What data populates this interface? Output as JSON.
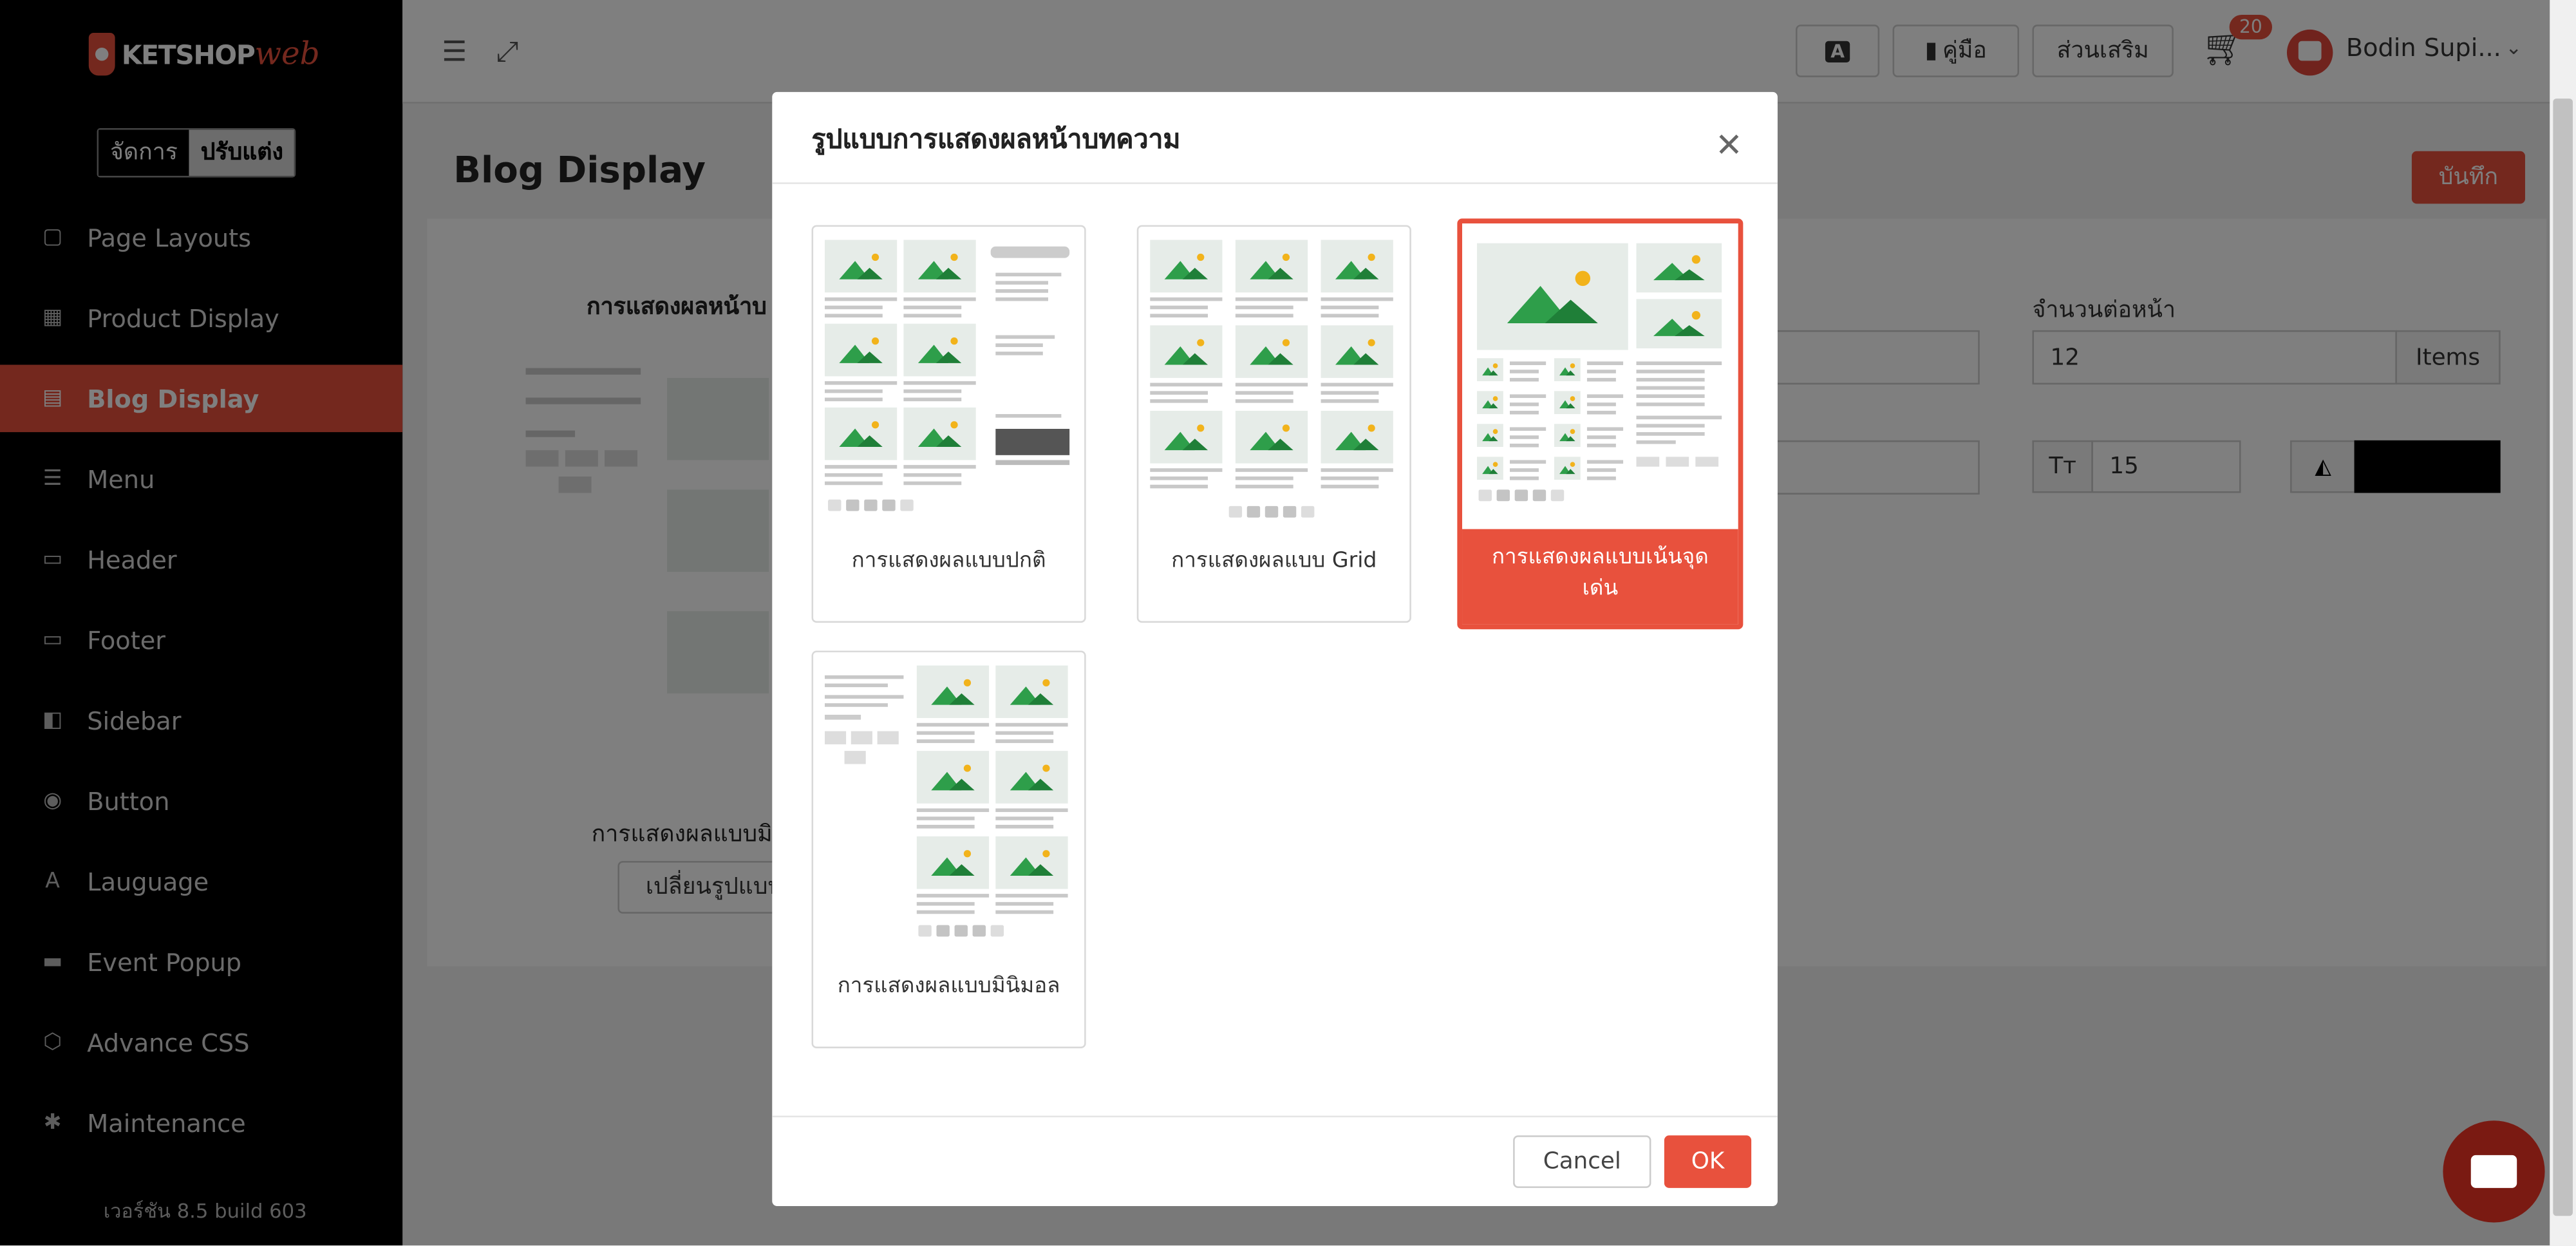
{
  "app": {
    "logo_text_1": "KETSHOP",
    "logo_text_2": "web",
    "mode_manage": "จัดการ",
    "mode_customize": "ปรับแต่ง",
    "version": "เวอร์ชัน 8.5 build 603"
  },
  "sidebar": {
    "items": [
      {
        "label": "Page Layouts",
        "icon": "page-layouts-icon",
        "glyph": "▢"
      },
      {
        "label": "Product Display",
        "icon": "product-display-icon",
        "glyph": "▦"
      },
      {
        "label": "Blog Display",
        "icon": "blog-display-icon",
        "glyph": "▤"
      },
      {
        "label": "Menu",
        "icon": "menu-icon",
        "glyph": "☰"
      },
      {
        "label": "Header",
        "icon": "header-icon",
        "glyph": "▭"
      },
      {
        "label": "Footer",
        "icon": "footer-icon",
        "glyph": "▭"
      },
      {
        "label": "Sidebar",
        "icon": "sidebar-icon",
        "glyph": "◧"
      },
      {
        "label": "Button",
        "icon": "toggle-icon",
        "glyph": "◉"
      },
      {
        "label": "Lauguage",
        "icon": "language-icon",
        "glyph": "A"
      },
      {
        "label": "Event Popup",
        "icon": "ticket-icon",
        "glyph": "▬"
      },
      {
        "label": "Advance CSS",
        "icon": "css3-icon",
        "glyph": "⬡"
      },
      {
        "label": "Maintenance",
        "icon": "bug-icon",
        "glyph": "✱"
      }
    ],
    "active_index": 2
  },
  "topbar": {
    "translate_icon": "translate-icon",
    "manual_label": "คู่มือ",
    "addon_label": "ส่วนเสริม",
    "cart_count": "20",
    "username": "Bodin Supi...",
    "chevron": "⌄"
  },
  "page": {
    "title": "Blog Display",
    "save_label": "บันทึก",
    "section_label": "การแสดงผลหน้าบ",
    "current_style": "การแสดงผลแบบมิ",
    "change_button": "เปลี่ยนรูปแบบ",
    "per_page_label": "จำนวนต่อหน้า",
    "per_page_value": "12",
    "per_page_unit": "Items",
    "font_size_icon": "Tт",
    "font_size_value": "15",
    "color_value": "#000000"
  },
  "modal": {
    "title": "รูปแบบการแสดงผลหน้าบทความ",
    "close_glyph": "✕",
    "options": [
      {
        "label": "การแสดงผลแบบปกติ",
        "layout": "sidebar-right"
      },
      {
        "label": "การแสดงผลแบบ Grid",
        "layout": "grid"
      },
      {
        "label": "การแสดงผลแบบเน้นจุดเด่น",
        "layout": "featured"
      },
      {
        "label": "การแสดงผลแบบมินิมอล",
        "layout": "minimal"
      }
    ],
    "selected_index": 2,
    "cancel_label": "Cancel",
    "ok_label": "OK"
  },
  "colors": {
    "accent": "#e8513d",
    "sidebar_bg": "#000000",
    "image_green": "#2e9e4a",
    "image_sun": "#f2b31b"
  }
}
